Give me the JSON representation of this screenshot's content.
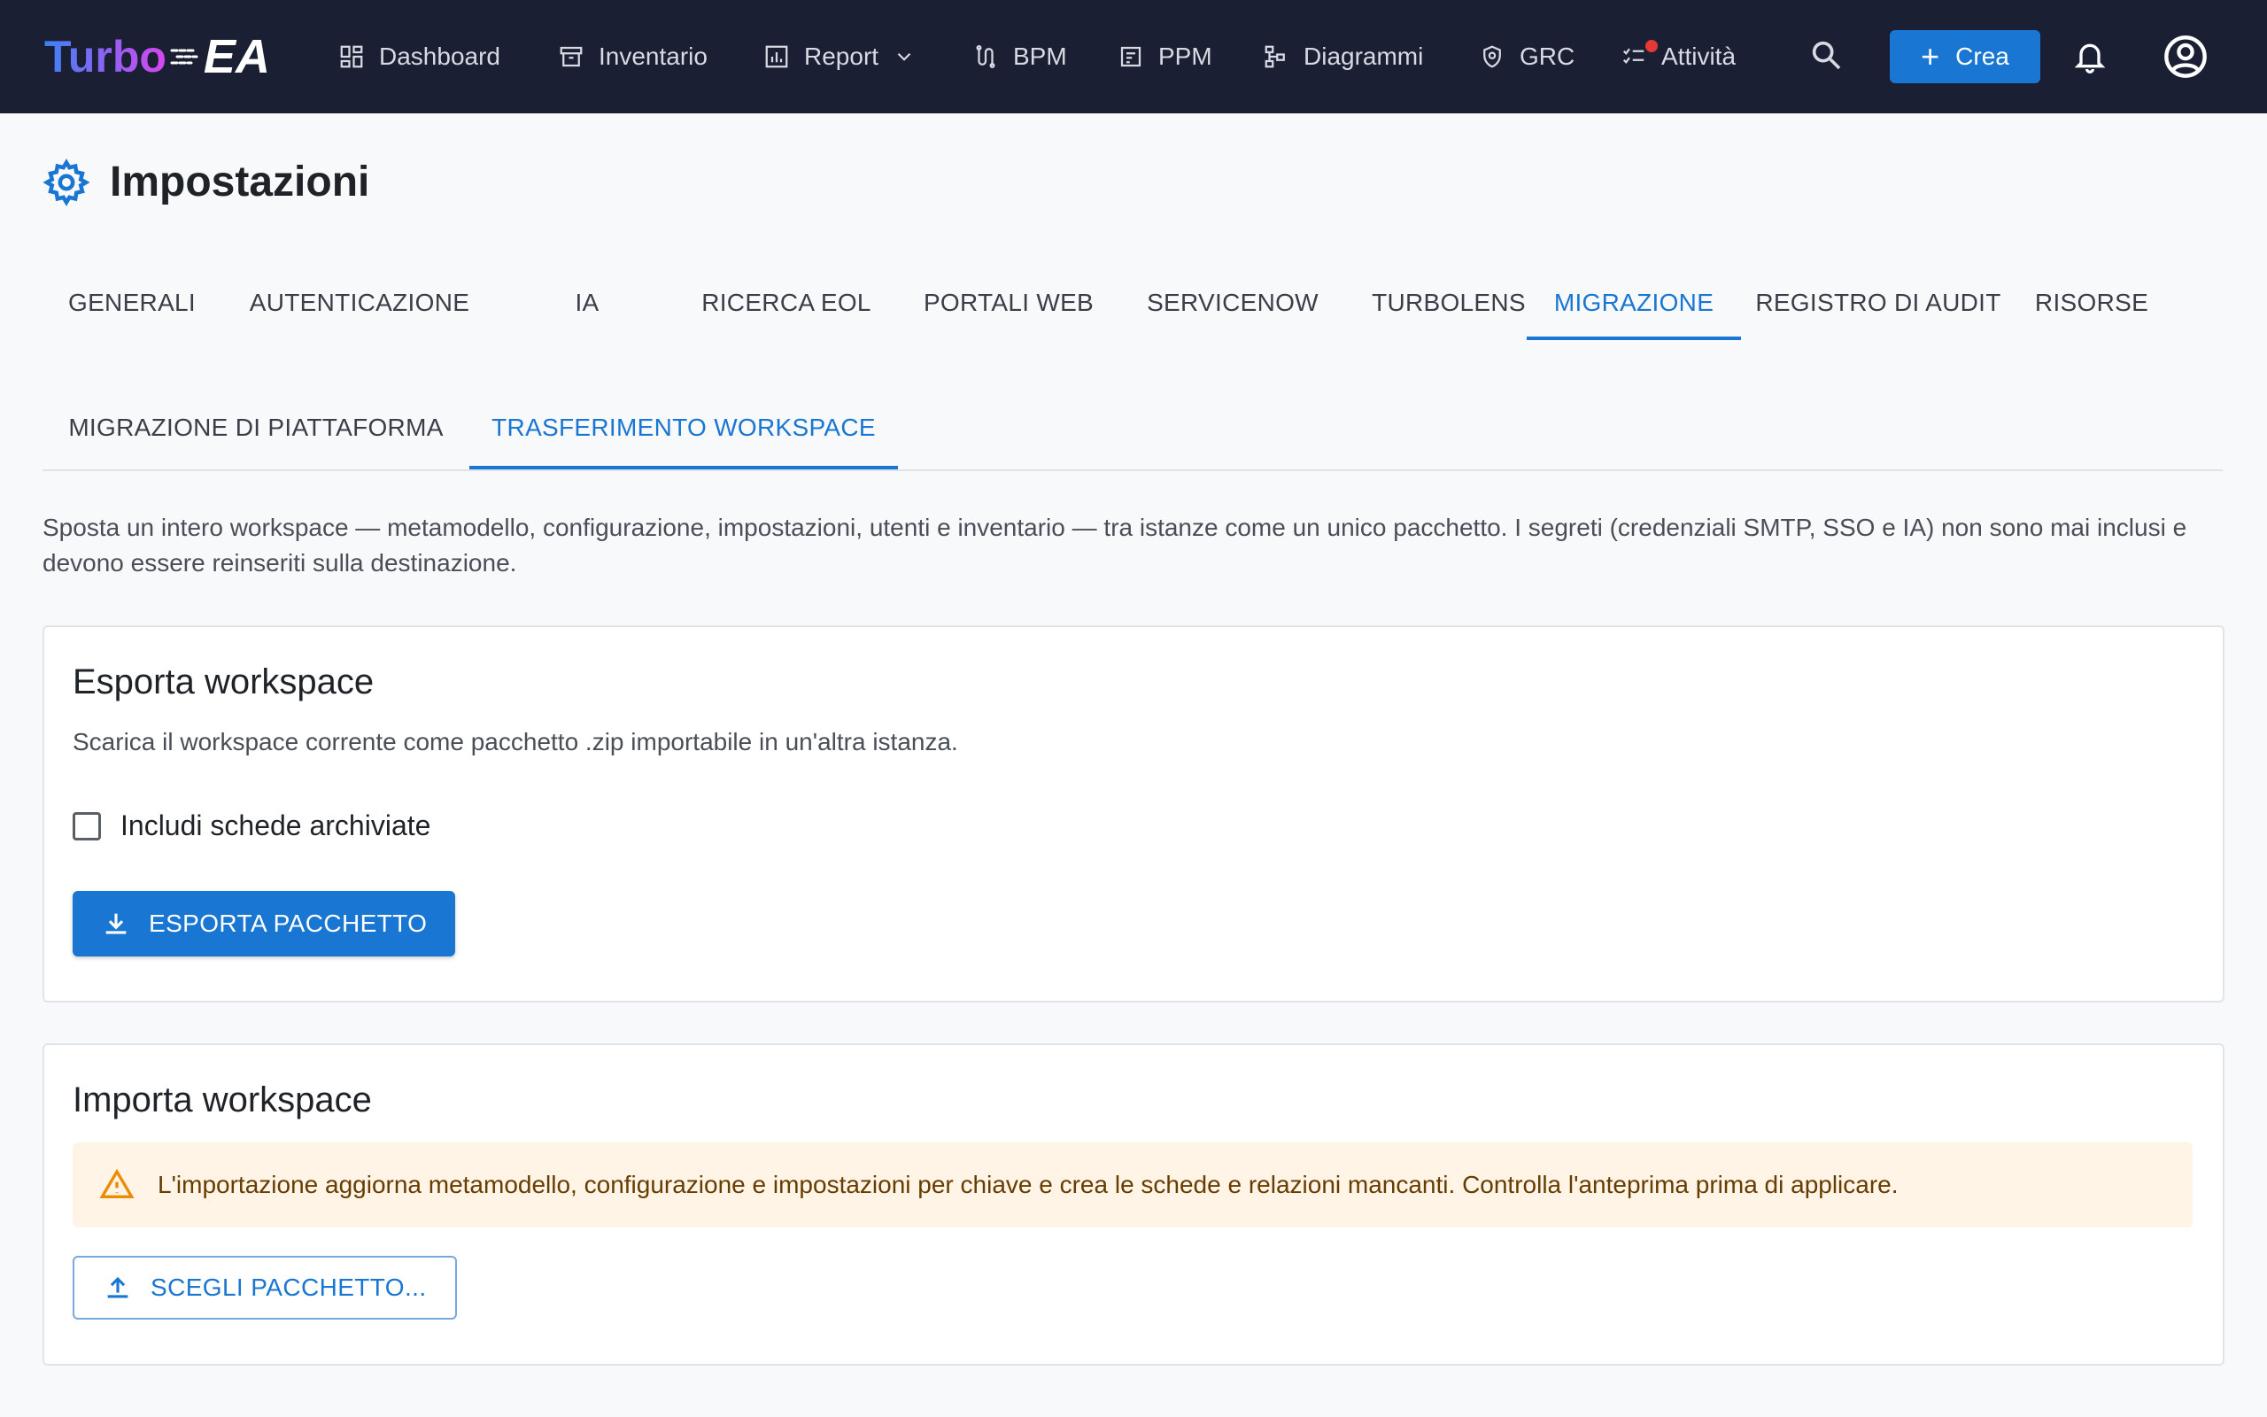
{
  "app": {
    "logo_part1": "Turbo",
    "logo_part2": "EA"
  },
  "nav": {
    "items": [
      {
        "label": "Dashboard",
        "icon": "dashboard-icon"
      },
      {
        "label": "Inventario",
        "icon": "inventory-icon"
      },
      {
        "label": "Report",
        "icon": "report-icon"
      },
      {
        "label": "BPM",
        "icon": "bpm-icon"
      },
      {
        "label": "PPM",
        "icon": "ppm-icon"
      },
      {
        "label": "Diagrammi",
        "icon": "diagram-icon"
      },
      {
        "label": "GRC",
        "icon": "shield-icon"
      },
      {
        "label": "Attività",
        "icon": "tasks-icon"
      }
    ],
    "create_label": "Crea"
  },
  "page": {
    "title": "Impostazioni"
  },
  "tabs": [
    {
      "label": "GENERALI"
    },
    {
      "label": "AUTENTICAZIONE"
    },
    {
      "label": "IA"
    },
    {
      "label": "RICERCA EOL"
    },
    {
      "label": "PORTALI WEB"
    },
    {
      "label": "SERVICENOW"
    },
    {
      "label": "TURBOLENS"
    },
    {
      "label": "MIGRAZIONE"
    },
    {
      "label": "REGISTRO DI AUDIT"
    },
    {
      "label": "RISORSE"
    }
  ],
  "active_tab": "MIGRAZIONE",
  "subtabs": [
    {
      "label": "MIGRAZIONE DI PIATTAFORMA"
    },
    {
      "label": "TRASFERIMENTO WORKSPACE"
    }
  ],
  "active_subtab": "TRASFERIMENTO WORKSPACE",
  "description": "Sposta un intero workspace — metamodello, configurazione, impostazioni, utenti e inventario — tra istanze come un unico pacchetto. I segreti (credenziali SMTP, SSO e IA) non sono mai inclusi e devono essere reinseriti sulla destinazione.",
  "export": {
    "title": "Esporta workspace",
    "subtitle": "Scarica il workspace corrente come pacchetto .zip importabile in un'altra istanza.",
    "checkbox_label": "Includi schede archiviate",
    "checkbox_checked": false,
    "button_label": "ESPORTA PACCHETTO"
  },
  "import": {
    "title": "Importa workspace",
    "warning": "L'importazione aggiorna metamodello, configurazione e impostazioni per chiave e crea le schede e relazioni mancanti. Controlla l'anteprima prima di applicare.",
    "button_label": "SCEGLI PACCHETTO..."
  },
  "colors": {
    "topbar_bg": "#1b1f33",
    "accent": "#1976d2",
    "logo_gradient_start": "#3b82f6",
    "logo_gradient_end": "#d946ef",
    "warning_bg": "#fff4e5",
    "warning_icon": "#ed8b00",
    "notification_dot": "#e53935"
  }
}
